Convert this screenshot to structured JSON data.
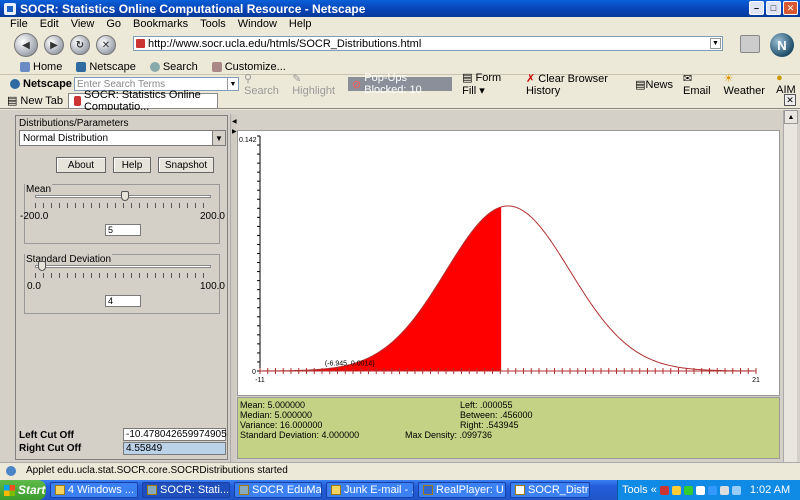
{
  "window": {
    "title": "SOCR: Statistics Online Computational Resource - Netscape"
  },
  "menu": [
    "File",
    "Edit",
    "View",
    "Go",
    "Bookmarks",
    "Tools",
    "Window",
    "Help"
  ],
  "nav": {
    "url": "http://www.socr.ucla.edu/htmls/SOCR_Distributions.html"
  },
  "personal_bar": {
    "home": "Home",
    "netscape": "Netscape",
    "search": "Search",
    "customize": "Customize..."
  },
  "search_bar": {
    "brand": "Netscape",
    "placeholder": "Enter Search Terms",
    "search": "Search",
    "highlight": "Highlight",
    "popups": "Pop-Ups Blocked: 10",
    "form_fill": "Form Fill",
    "clear_history": "Clear Browser History",
    "news": "News",
    "email": "Email",
    "weather": "Weather",
    "aim": "AIM"
  },
  "tabs": {
    "new_tab": "New Tab",
    "active": "SOCR: Statistics Online Computatio..."
  },
  "panel": {
    "title": "Distributions/Parameters",
    "distribution": "Normal Distribution",
    "buttons": {
      "about": "About",
      "help": "Help",
      "snapshot": "Snapshot"
    },
    "mean": {
      "label": "Mean",
      "min": "-200.0",
      "max": "200.0",
      "value": "5",
      "position": 0.5125
    },
    "sd": {
      "label": "Standard Deviation",
      "min": "0.0",
      "max": "100.0",
      "value": "4",
      "position": 0.04
    },
    "left_cut": {
      "label": "Left Cut Off",
      "value": "-10.478042659974905"
    },
    "right_cut": {
      "label": "Right Cut Off",
      "value": "4.55849"
    }
  },
  "chart_data": {
    "type": "area",
    "distribution": "normal",
    "mean": 5,
    "sd": 4,
    "xlim": [
      -11,
      21
    ],
    "ylim": [
      0,
      0.142
    ],
    "x_tick_labels": [
      "-11",
      "21"
    ],
    "y_tick_labels": [
      "0",
      "0.142"
    ],
    "shaded_interval": [
      -10.478042659974905,
      4.55849
    ],
    "shade_color": "#ff0000",
    "curve_color": "#b03030",
    "annotation": "(-6.945, 0.0014)",
    "annotation_point": [
      -6.945,
      0.0014
    ]
  },
  "stats": {
    "mean": "Mean: 5.000000",
    "median": "Median: 5.000000",
    "variance": "Variance: 16.000000",
    "sd": "Standard Deviation: 4.000000",
    "left": "Left: .000055",
    "between": "Between: .456000",
    "right": "Right: .543945",
    "max_density": "Max Density: .099736"
  },
  "status": "Applet edu.ucla.stat.SOCR.core.SOCRDistributions started",
  "taskbar": {
    "start": "Start",
    "tasks": [
      "4 Windows ...",
      "SOCR: Stati...",
      "SOCR EduMat...",
      "Junk E-mail - ...",
      "RealPlayer: U...",
      "SOCR_Distrib..."
    ],
    "tools": "Tools",
    "clock": "1:02 AM"
  }
}
